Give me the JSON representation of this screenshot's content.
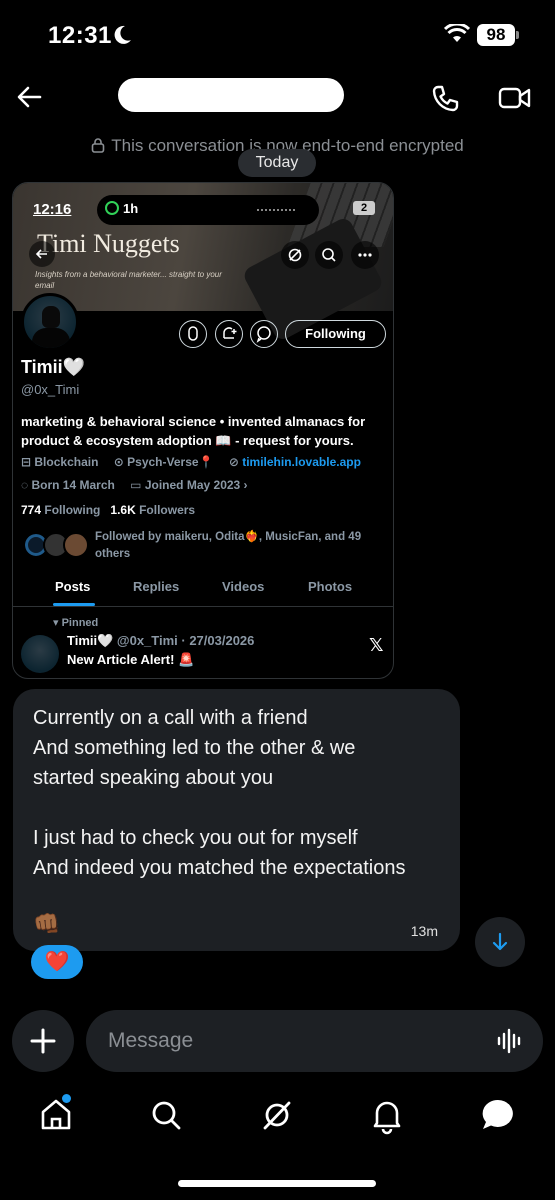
{
  "status_bar": {
    "time": "12:31",
    "battery": "98"
  },
  "header": {
    "encryption_notice": "This conversation is now end-to-end encrypted",
    "date_separator": "Today"
  },
  "shared_card": {
    "phone_time": "12:16",
    "call_duration": "1h",
    "mini_battery": "2",
    "banner_title": "Timi Nuggets",
    "banner_subtitle": "Insights from a behavioral marketer... straight to your email",
    "following_label": "Following",
    "display_name": "Timii🤍",
    "handle": "@0x_Timi",
    "bio": "marketing & behavioral science • invented almanacs for product & ecosystem adoption 📖 - request for yours.",
    "meta_row1": {
      "category": "Blockchain",
      "location": "Psych-Verse📍",
      "website": "timilehin.lovable.app"
    },
    "meta_row2": {
      "born": "Born 14 March",
      "joined": "Joined May 2023 ›"
    },
    "counts": {
      "following_count": "774",
      "following_label": "Following",
      "followers_count": "1.6K",
      "followers_label": "Followers"
    },
    "followed_by": "Followed by maikeru, Odita❤️‍🔥, MusicFan, and 49 others",
    "tabs": [
      "Posts",
      "Replies",
      "Videos",
      "Photos"
    ],
    "pinned_label": "Pinned",
    "pinned_author": "Timii🤍",
    "pinned_meta": "@0x_Timi · 27/03/2026",
    "pinned_text": "New Article Alert! 🚨"
  },
  "message": {
    "text": "Currently on a call with a friend\nAnd something led to the other & we\nstarted speaking about you\n\nI just had to check you out for myself\nAnd indeed you matched the expectations",
    "emoji": "👊🏾",
    "time": "13m",
    "reaction": "❤️"
  },
  "composer": {
    "placeholder": "Message"
  },
  "colors": {
    "accent": "#1d9bf0",
    "bubble": "#1d2024",
    "muted": "#8b98a5"
  }
}
